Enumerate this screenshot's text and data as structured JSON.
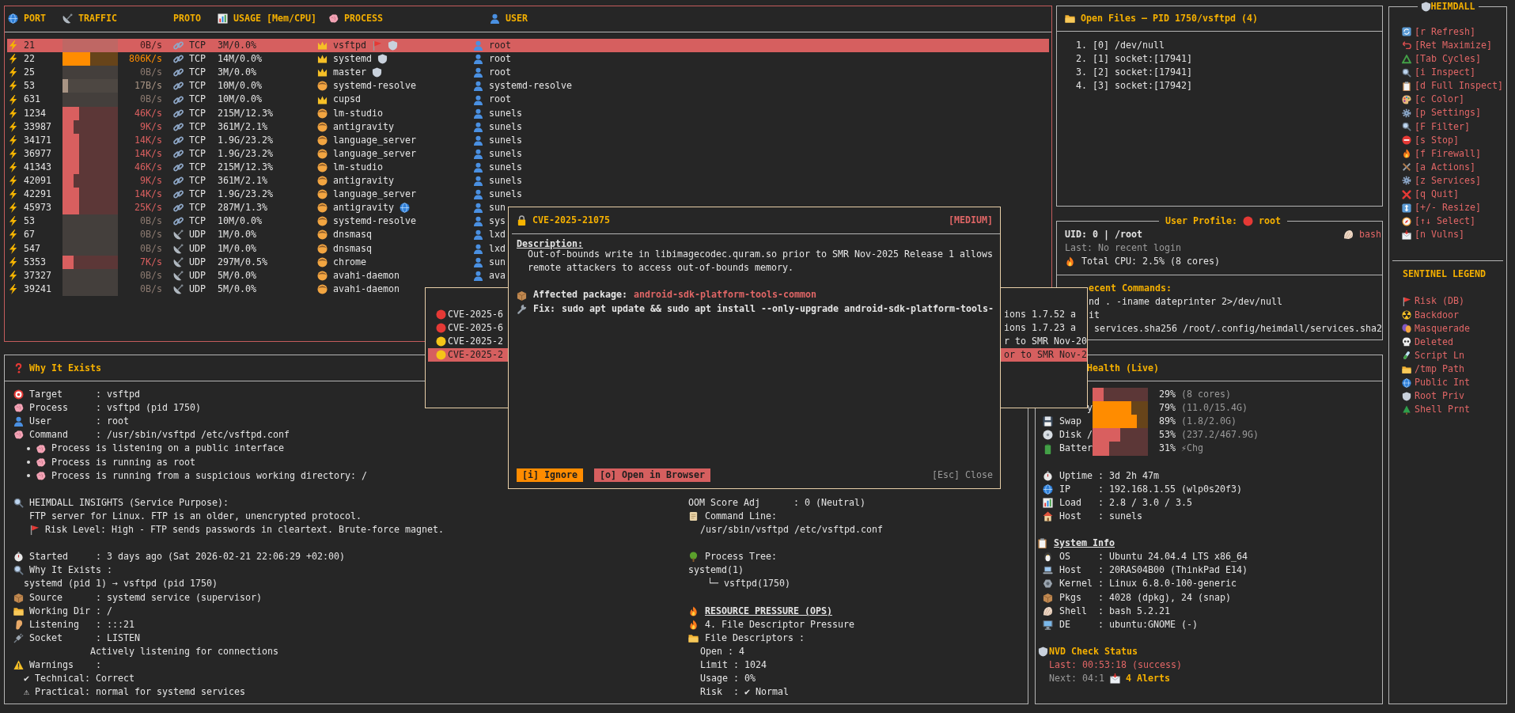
{
  "connections": {
    "columns": [
      "PORT",
      "TRAFFIC",
      "PROTO",
      "USAGE [Mem/CPU]",
      "PROCESS",
      "USER"
    ],
    "rows": [
      {
        "port": "21",
        "level": 0,
        "traffic": "0B/s",
        "proto": "TCP",
        "kind": "tcp",
        "usage": "3M/0.0%",
        "process": "vsftpd",
        "privileged": true,
        "risk": true,
        "root_priv": true,
        "public_int": false,
        "user": "root",
        "selected": true
      },
      {
        "port": "22",
        "level": 0.5,
        "color": "#ff8c00",
        "traffic": "806K/s",
        "proto": "TCP",
        "kind": "tcp",
        "usage": "14M/0.0%",
        "process": "systemd",
        "privileged": true,
        "risk": false,
        "root_priv": true,
        "public_int": false,
        "user": "root",
        "selected": false
      },
      {
        "port": "25",
        "level": 0,
        "color": "#8c7a70",
        "traffic": "0B/s",
        "proto": "TCP",
        "kind": "tcp",
        "usage": "3M/0.0%",
        "process": "master",
        "privileged": true,
        "risk": false,
        "root_priv": true,
        "public_int": false,
        "user": "root",
        "selected": false
      },
      {
        "port": "53",
        "level": 0.1,
        "color": "#a89484",
        "traffic": "17B/s",
        "proto": "TCP",
        "kind": "tcp",
        "usage": "10M/0.0%",
        "process": "systemd-resolve",
        "privileged": false,
        "risk": false,
        "root_priv": false,
        "public_int": false,
        "user": "systemd-resolve",
        "selected": false
      },
      {
        "port": "631",
        "level": 0,
        "color": "#8c7a70",
        "traffic": "0B/s",
        "proto": "TCP",
        "kind": "tcp",
        "usage": "10M/0.0%",
        "process": "cupsd",
        "privileged": true,
        "risk": false,
        "root_priv": false,
        "public_int": false,
        "user": "root",
        "selected": false
      },
      {
        "port": "1234",
        "level": 0.3,
        "color": "#d95f5f",
        "traffic": "46K/s",
        "proto": "TCP",
        "kind": "tcp",
        "usage": "215M/12.3%",
        "process": "lm-studio",
        "privileged": false,
        "risk": false,
        "root_priv": false,
        "public_int": false,
        "user": "sunels",
        "selected": false
      },
      {
        "port": "33987",
        "level": 0.2,
        "color": "#d95f5f",
        "traffic": "9K/s",
        "proto": "TCP",
        "kind": "tcp",
        "usage": "361M/2.1%",
        "process": "antigravity",
        "privileged": false,
        "risk": false,
        "root_priv": false,
        "public_int": false,
        "user": "sunels",
        "selected": false
      },
      {
        "port": "34171",
        "level": 0.3,
        "color": "#d95f5f",
        "traffic": "14K/s",
        "proto": "TCP",
        "kind": "tcp",
        "usage": "1.9G/23.2%",
        "process": "language_server",
        "privileged": false,
        "risk": false,
        "root_priv": false,
        "public_int": false,
        "user": "sunels",
        "selected": false
      },
      {
        "port": "36977",
        "level": 0.3,
        "color": "#d95f5f",
        "traffic": "14K/s",
        "proto": "TCP",
        "kind": "tcp",
        "usage": "1.9G/23.2%",
        "process": "language_server",
        "privileged": false,
        "risk": false,
        "root_priv": false,
        "public_int": false,
        "user": "sunels",
        "selected": false
      },
      {
        "port": "41343",
        "level": 0.3,
        "color": "#d95f5f",
        "traffic": "46K/s",
        "proto": "TCP",
        "kind": "tcp",
        "usage": "215M/12.3%",
        "process": "lm-studio",
        "privileged": false,
        "risk": false,
        "root_priv": false,
        "public_int": false,
        "user": "sunels",
        "selected": false
      },
      {
        "port": "42091",
        "level": 0.2,
        "color": "#d95f5f",
        "traffic": "9K/s",
        "proto": "TCP",
        "kind": "tcp",
        "usage": "361M/2.1%",
        "process": "antigravity",
        "privileged": false,
        "risk": false,
        "root_priv": false,
        "public_int": false,
        "user": "sunels",
        "selected": false
      },
      {
        "port": "42291",
        "level": 0.3,
        "color": "#d95f5f",
        "traffic": "14K/s",
        "proto": "TCP",
        "kind": "tcp",
        "usage": "1.9G/23.2%",
        "process": "language_server",
        "privileged": false,
        "risk": false,
        "root_priv": false,
        "public_int": false,
        "user": "sunels",
        "selected": false
      },
      {
        "port": "45973",
        "level": 0.3,
        "color": "#d95f5f",
        "traffic": "25K/s",
        "proto": "TCP",
        "kind": "tcp",
        "usage": "287M/1.3%",
        "process": "antigravity",
        "privileged": false,
        "risk": false,
        "root_priv": false,
        "public_int": true,
        "user": "sun",
        "selected": false
      },
      {
        "port": "53",
        "level": 0,
        "color": "#8c7a70",
        "traffic": "0B/s",
        "proto": "TCP",
        "kind": "tcp",
        "usage": "10M/0.0%",
        "process": "systemd-resolve",
        "privileged": false,
        "risk": false,
        "root_priv": false,
        "public_int": false,
        "user": "sys",
        "selected": false
      },
      {
        "port": "67",
        "level": 0,
        "color": "#8c7a70",
        "traffic": "0B/s",
        "proto": "UDP",
        "kind": "udp",
        "usage": "1M/0.0%",
        "process": "dnsmasq",
        "privileged": false,
        "risk": false,
        "root_priv": false,
        "public_int": false,
        "user": "lxd",
        "selected": false
      },
      {
        "port": "547",
        "level": 0,
        "color": "#8c7a70",
        "traffic": "0B/s",
        "proto": "UDP",
        "kind": "udp",
        "usage": "1M/0.0%",
        "process": "dnsmasq",
        "privileged": false,
        "risk": false,
        "root_priv": false,
        "public_int": false,
        "user": "lxd",
        "selected": false
      },
      {
        "port": "5353",
        "level": 0.2,
        "color": "#d95f5f",
        "traffic": "7K/s",
        "proto": "UDP",
        "kind": "udp",
        "usage": "297M/0.5%",
        "process": "chrome",
        "privileged": false,
        "risk": false,
        "root_priv": false,
        "public_int": false,
        "user": "sun",
        "selected": false
      },
      {
        "port": "37327",
        "level": 0,
        "color": "#8c7a70",
        "traffic": "0B/s",
        "proto": "UDP",
        "kind": "udp",
        "usage": "5M/0.0%",
        "process": "avahi-daemon",
        "privileged": false,
        "risk": false,
        "root_priv": false,
        "public_int": false,
        "user": "ava",
        "selected": false
      },
      {
        "port": "39241",
        "level": 0,
        "color": "#8c7a70",
        "traffic": "0B/s",
        "proto": "UDP",
        "kind": "udp",
        "usage": "5M/0.0%",
        "process": "avahi-daemon",
        "privileged": false,
        "risk": false,
        "root_priv": false,
        "public_int": false,
        "selected": false
      }
    ]
  },
  "open_files": {
    "title": "Open Files — PID 1750/vsftpd (4)",
    "items": [
      "1. [0] /dev/null",
      "2. [1] socket:[17941]",
      "3. [2] socket:[17941]",
      "4. [3] socket:[17942]"
    ]
  },
  "profile": {
    "title": "User Profile:",
    "user": "root",
    "uid": "UID: 0 | /root",
    "shell": "bash",
    "last_login": "Last: No recent login",
    "cpu": "Total CPU: 2.5% (8 cores)",
    "commands_title": "ecent Commands:",
    "commands": [
      "nd . -iname dateprinter 2>/dev/null",
      "it",
      "services.sha256 /root/.config/heimdall/services.sha2"
    ]
  },
  "why": {
    "title": "Why It Exists",
    "blocks": [
      [
        {
          "kind": "field",
          "text": "Target      : vsftpd"
        },
        {
          "kind": "field",
          "text": "Process     : vsftpd (pid 1750)"
        },
        {
          "kind": "field",
          "text": "User        : root"
        },
        {
          "kind": "field",
          "text": "Command     : /usr/sbin/vsftpd /etc/vsftpd.conf"
        },
        {
          "kind": "bullet",
          "text": "Process is listening on a public interface"
        },
        {
          "kind": "bullet",
          "text": "Process is running as root"
        },
        {
          "kind": "bullet",
          "text": "Process is running from a suspicious working directory: /"
        }
      ],
      [
        {
          "kind": "field",
          "text": "HEIMDALL INSIGHTS (Service Purpose):"
        },
        {
          "kind": "indent",
          "text": "FTP server for Linux. FTP is an older, unencrypted protocol."
        },
        {
          "kind": "note",
          "text": "Risk Level: High - FTP sends passwords in cleartext. Brute-force magnet."
        }
      ],
      [
        {
          "kind": "field",
          "text": "Started     : 3 days ago (Sat 2026-02-21 22:06:29 +02:00)"
        },
        {
          "kind": "field",
          "text": "Why It Exists :"
        },
        {
          "kind": "sub",
          "text": "systemd (pid 1) → vsftpd (pid 1750)"
        },
        {
          "kind": "field",
          "text": "Source      : systemd service (supervisor)"
        },
        {
          "kind": "field",
          "text": "Working Dir : /"
        },
        {
          "kind": "field",
          "text": "Listening   : :::21"
        },
        {
          "kind": "field",
          "text": "Socket      : LISTEN"
        },
        {
          "kind": "deep",
          "text": "Actively listening for connections"
        },
        {
          "kind": "field",
          "text": "Warnings    :"
        },
        {
          "kind": "sub",
          "text": "✔ Technical: Correct"
        },
        {
          "kind": "sub",
          "text": "⚠ Practical: normal for systemd services"
        }
      ]
    ]
  },
  "details": {
    "blocks": [
      [
        {
          "kind": "plain",
          "text": "OOM Score Adj      : 0 (Neutral)"
        },
        {
          "kind": "field",
          "text": "Command Line:"
        },
        {
          "kind": "indent",
          "text": "/usr/sbin/vsftpd /etc/vsftpd.conf"
        }
      ],
      [
        {
          "kind": "field",
          "text": "Process Tree:"
        },
        {
          "kind": "plain",
          "text": "systemd(1)"
        },
        {
          "kind": "tree",
          "text": "└─ vsftpd(1750)"
        }
      ],
      [
        {
          "kind": "heading",
          "text": "RESOURCE PRESSURE (OPS)"
        },
        {
          "kind": "field",
          "text": "4. File Descriptor Pressure"
        },
        {
          "kind": "field",
          "text": "File Descriptors :"
        },
        {
          "kind": "indent",
          "text": "Open : 4"
        },
        {
          "kind": "indent",
          "text": "Limit : 1024"
        },
        {
          "kind": "indent",
          "text": "Usage : 0%"
        },
        {
          "kind": "indent",
          "text": "Risk  : ✔ Normal"
        }
      ]
    ]
  },
  "health": {
    "title": "Health (Live)",
    "meters": [
      {
        "level": 0.2,
        "color": "#d95f5f",
        "reading": "29%",
        "detail": "(8 cores)"
      },
      {
        "label": "y",
        "level": 0.7,
        "color": "#ff8c00",
        "reading": "79%",
        "detail": "(11.0/15.4G)"
      },
      {
        "label": "Swap",
        "level": 0.8,
        "color": "#ff8c00",
        "reading": "89%",
        "detail": "(1.8/2.0G)"
      },
      {
        "label": "Disk /",
        "level": 0.5,
        "color": "#d95f5f",
        "reading": "53%",
        "detail": "(237.2/467.9G)"
      },
      {
        "label": "Batter",
        "level": 0.3,
        "color": "#d95f5f",
        "reading": "31%",
        "detail": "⚡Chg"
      }
    ],
    "blocks": [
      [
        {
          "kind": "field",
          "text": "Uptime : 3d 2h 47m"
        },
        {
          "kind": "field",
          "text": "IP     : 192.168.1.55 (wlp0s20f3)"
        },
        {
          "kind": "field",
          "text": "Load   : 2.8 / 3.0 / 3.5"
        },
        {
          "kind": "field",
          "text": "Host   : sunels"
        }
      ],
      [
        {
          "kind": "heading",
          "text": "System Info"
        },
        {
          "kind": "field",
          "text": "OS     : Ubuntu 24.04.4 LTS x86_64"
        },
        {
          "kind": "field",
          "text": "Host   : 20RAS04B00 (ThinkPad E14)"
        },
        {
          "kind": "field",
          "text": "Kernel : Linux 6.8.0-100-generic"
        },
        {
          "kind": "field",
          "text": "Pkgs   : 4028 (dpkg), 24 (snap)"
        },
        {
          "kind": "field",
          "text": "Shell  : bash 5.2.21"
        },
        {
          "kind": "field",
          "text": "DE     : ubuntu:GNOME (-)"
        }
      ],
      [
        {
          "kind": "status_title",
          "text": "NVD Check Status"
        },
        {
          "kind": "last_check",
          "text": "Last: 00:53:18 (success)"
        },
        {
          "kind": "next_check",
          "text": "Next: 04:1",
          "alerts": "4 Alerts"
        }
      ]
    ]
  },
  "sidebar": {
    "title": "HEIMDALL",
    "shortcuts": [
      "[r Refresh]",
      "[Ret Maximize]",
      "[Tab Cycles]",
      "[i Inspect]",
      "[d Full Inspect]",
      "[c Color]",
      "[p Settings]",
      "[F Filter]",
      "[s Stop]",
      "[f Firewall]",
      "[a Actions]",
      "[z Services]",
      "[q Quit]",
      "[+/- Resize]",
      "[↑↓ Select]",
      "[n Vulns]"
    ],
    "legend_title": "SENTINEL LEGEND",
    "legend": [
      "Risk (DB)",
      "Backdoor",
      "Masquerade",
      "Deleted",
      "Script Ln",
      "/tmp Path",
      "Public Int",
      "Root Priv",
      "Shell Prnt"
    ]
  },
  "cve_list": {
    "items": [
      {
        "color": "#e53935",
        "cve": "CVE-2025-6",
        "tail": "ions 1.7.52 a",
        "selected": false
      },
      {
        "color": "#e53935",
        "cve": "CVE-2025-6",
        "tail": "ions 1.7.23 a",
        "selected": false
      },
      {
        "color": "#f5c518",
        "cve": "CVE-2025-2",
        "tail": "r to SMR Nov-20",
        "selected": false
      },
      {
        "color": "#f5c518",
        "cve": "CVE-2025-2",
        "tail": "or to SMR Nov-2",
        "selected": true
      }
    ]
  },
  "cve_modal": {
    "title": "CVE-2025-21075",
    "severity": "[MEDIUM]",
    "description_label": "Description:",
    "description": "Out-of-bounds write in libimagecodec.quram.so prior to SMR Nov-2025 Release 1 allows remote attackers to access out-of-bounds memory.",
    "package_label": "Affected package:",
    "package": "android-sdk-platform-tools-common",
    "fix_label": "Fix:",
    "fix": "sudo apt update && sudo apt install --only-upgrade android-sdk-platform-tools-",
    "buttons": [
      {
        "kind": "ignore",
        "label": "[i] Ignore"
      },
      {
        "kind": "open",
        "label": "[o] Open in Browser"
      },
      {
        "kind": "close",
        "label": "[Esc] Close"
      }
    ]
  }
}
